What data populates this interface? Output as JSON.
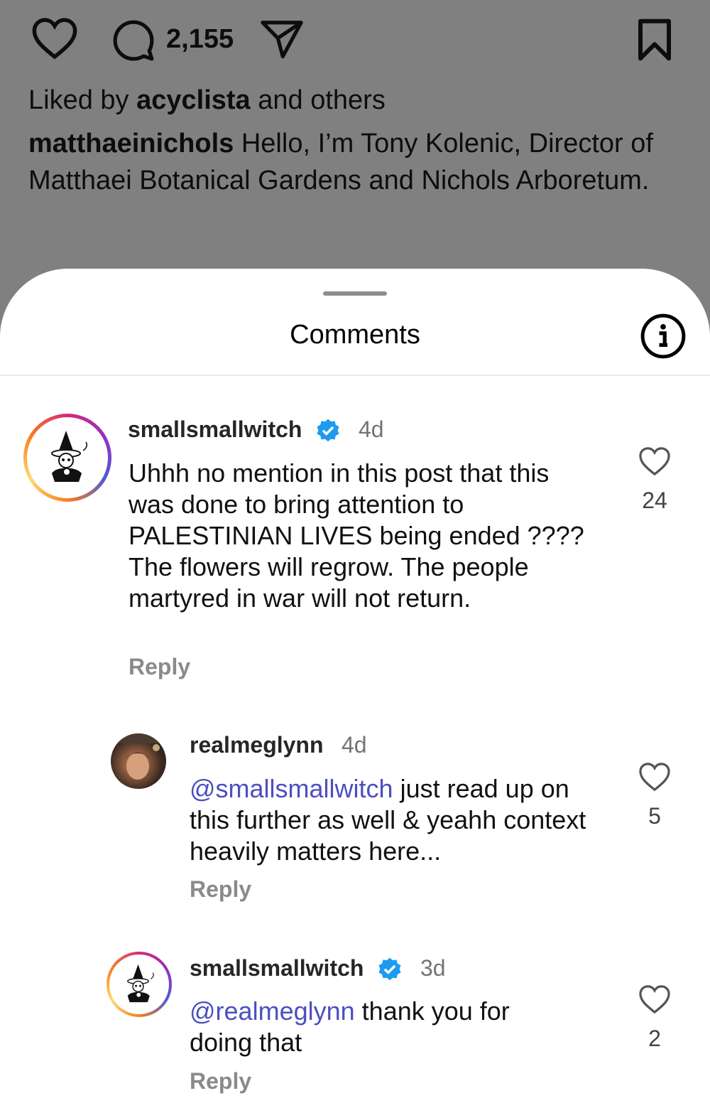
{
  "post": {
    "comment_count": "2,155",
    "liked_by_prefix": "Liked by",
    "liked_by_user": "acyclista",
    "liked_by_suffix": "and others",
    "caption_user": "matthaeinichols",
    "caption_text": "Hello, I’m Tony Kolenic, Director of Matthaei Botanical Gardens and Nichols Arboretum."
  },
  "sheet": {
    "title": "Comments",
    "info_icon": "info-icon"
  },
  "comments": [
    {
      "user": "smallsmallwitch",
      "verified": true,
      "age": "4d",
      "mention": "",
      "text": "Uhhh no mention in this post that this was done to bring attention to PALESTINIAN LIVES being ended ???? The flowers will regrow. The people martyred in war will not return.",
      "reply_label": "Reply",
      "likes": "24"
    },
    {
      "user": "realmeglynn",
      "verified": false,
      "age": "4d",
      "mention": "@smallsmallwitch",
      "text": "just read up on this further as well & yeahh context heavily matters here...",
      "reply_label": "Reply",
      "likes": "5"
    },
    {
      "user": "smallsmallwitch",
      "verified": true,
      "age": "3d",
      "mention": "@realmeglynn",
      "text": "thank you for doing that",
      "reply_label": "Reply",
      "likes": "2"
    }
  ],
  "colors": {
    "dim_background": "#808080",
    "mention": "#4b4fc1",
    "verified": "#1d9bf0",
    "muted": "#737373"
  }
}
